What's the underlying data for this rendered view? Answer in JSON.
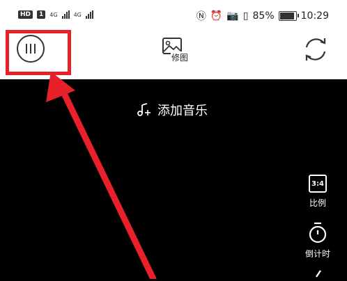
{
  "status_bar": {
    "hd_badge": "HD",
    "sim1": "1",
    "net1": "4G",
    "net2": "4G",
    "battery_percent": "85%",
    "time": "10:29"
  },
  "toolbar": {
    "edit_label": "修图"
  },
  "camera": {
    "add_music_label": "添加音乐",
    "ratio_value": "3:4",
    "ratio_label": "比例",
    "timer_label": "倒计时"
  },
  "annotation_color": "#e8202a"
}
